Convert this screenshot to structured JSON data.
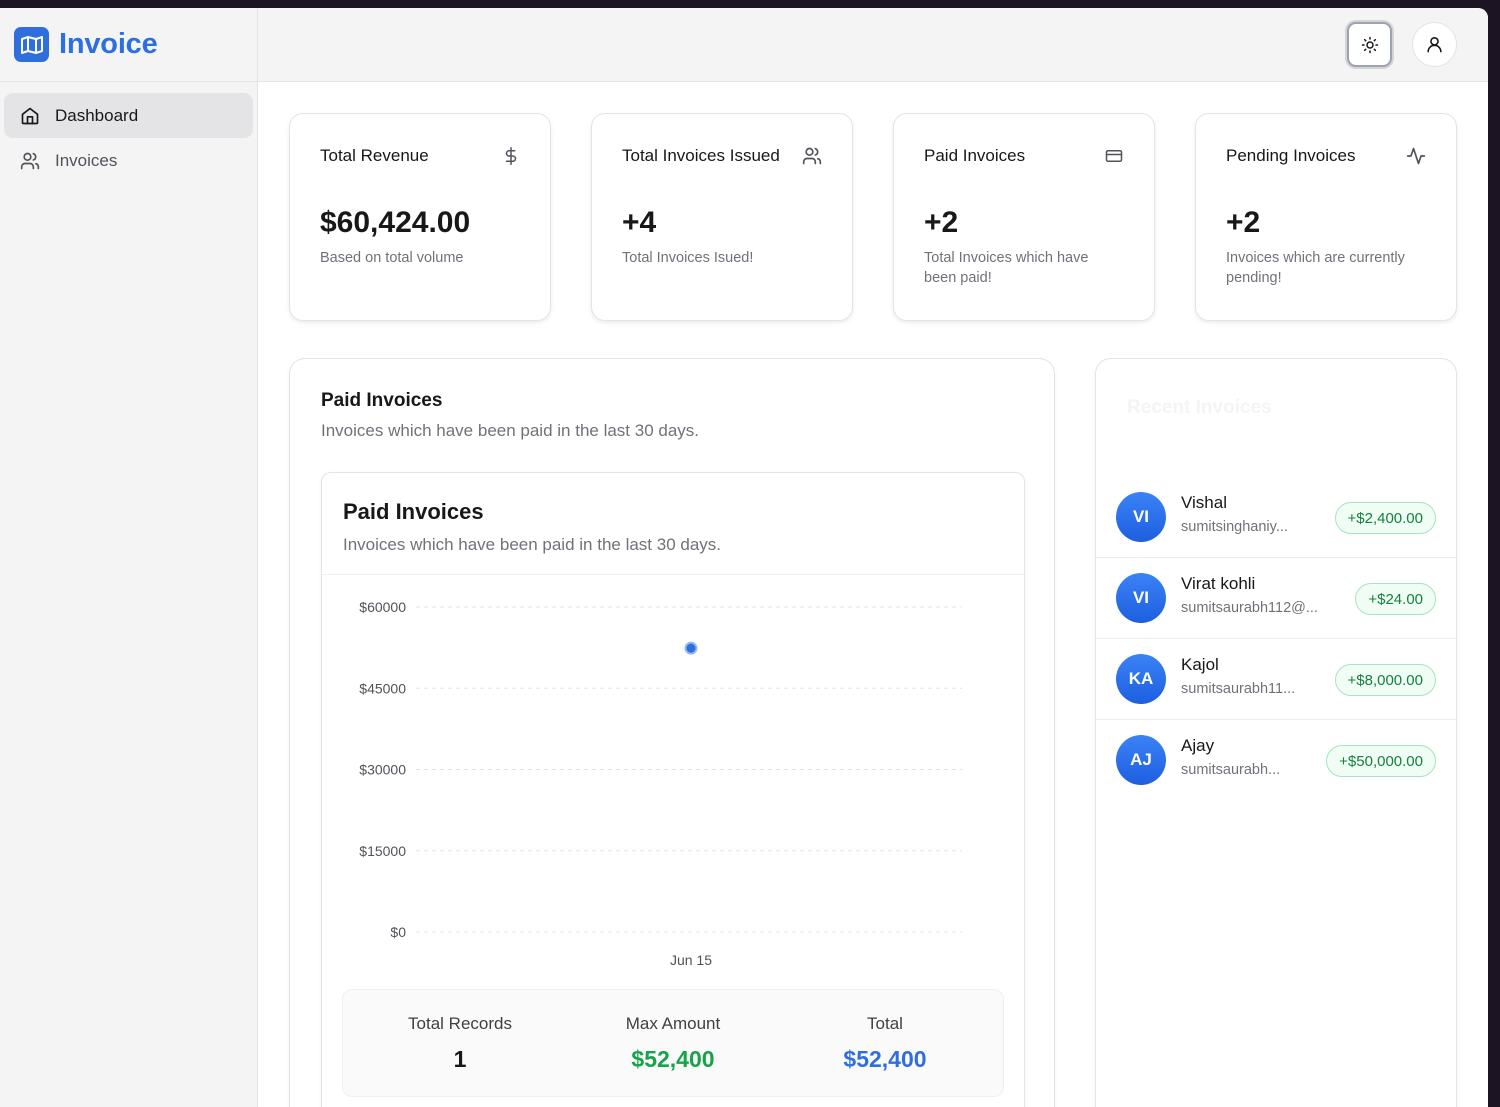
{
  "brand": {
    "name": "Invoice"
  },
  "sidebar": {
    "items": [
      {
        "label": "Dashboard",
        "icon": "home-icon",
        "active": true
      },
      {
        "label": "Invoices",
        "icon": "users-icon",
        "active": false
      }
    ]
  },
  "header": {
    "theme_icon": "sun-icon",
    "user_icon": "user-icon"
  },
  "stats": [
    {
      "title": "Total Revenue",
      "icon": "dollar-icon",
      "value": "$60,424.00",
      "sub": "Based on total volume"
    },
    {
      "title": "Total Invoices Issued",
      "icon": "users-icon",
      "value": "+4",
      "sub": "Total Invoices Isued!"
    },
    {
      "title": "Paid Invoices",
      "icon": "credit-card-icon",
      "value": "+2",
      "sub": "Total Invoices which have been paid!"
    },
    {
      "title": "Pending Invoices",
      "icon": "activity-icon",
      "value": "+2",
      "sub": "Invoices which are currently pending!"
    }
  ],
  "paid_section": {
    "title": "Paid Invoices",
    "description": "Invoices which have been paid in the last 30 days.",
    "inner_title": "Paid Invoices",
    "inner_description": "Invoices which have been paid in the last 30 days.",
    "summary": {
      "records_label": "Total Records",
      "records_value": "1",
      "max_label": "Max Amount",
      "max_value": "$52,400",
      "total_label": "Total",
      "total_value": "$52,400"
    }
  },
  "chart_data": {
    "type": "scatter",
    "x": [
      "Jun 15"
    ],
    "y_ticks": [
      "$60000",
      "$45000",
      "$30000",
      "$15000",
      "$0"
    ],
    "ylim": [
      0,
      60000
    ],
    "series": [
      {
        "values": [
          52400
        ]
      }
    ],
    "grid": true,
    "point_color": "#2f6fdd"
  },
  "recent": {
    "title": "Recent Invoices",
    "items": [
      {
        "initials": "VI",
        "name": "Vishal",
        "email": "sumitsinghaniy...",
        "amount": "+$2,400.00"
      },
      {
        "initials": "VI",
        "name": "Virat kohli",
        "email": "sumitsaurabh112@...",
        "amount": "+$24.00"
      },
      {
        "initials": "KA",
        "name": "Kajol",
        "email": "sumitsaurabh11...",
        "amount": "+$8,000.00"
      },
      {
        "initials": "AJ",
        "name": "Ajay",
        "email": "sumitsaurabh...",
        "amount": "+$50,000.00"
      }
    ]
  },
  "colors": {
    "accent": "#2d6fe0",
    "green": "#16a34a",
    "blue": "#2f6fdd"
  }
}
